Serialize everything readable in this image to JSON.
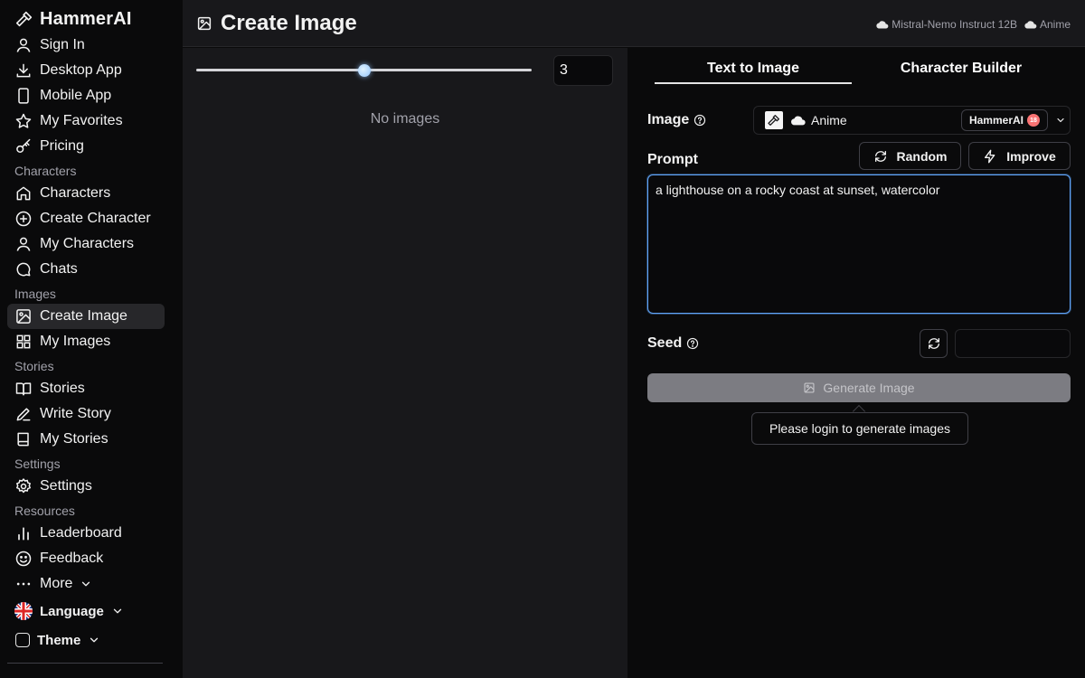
{
  "sidebar": {
    "brand": "HammerAI",
    "top_items": [
      {
        "label": "Sign In",
        "icon": "user-icon"
      },
      {
        "label": "Desktop App",
        "icon": "download-icon"
      },
      {
        "label": "Mobile App",
        "icon": "phone-icon"
      },
      {
        "label": "My Favorites",
        "icon": "star-icon"
      },
      {
        "label": "Pricing",
        "icon": "key-icon"
      }
    ],
    "sections": {
      "characters": "Characters",
      "images": "Images",
      "stories": "Stories",
      "settings": "Settings",
      "resources": "Resources"
    },
    "character_items": [
      {
        "label": "Characters",
        "icon": "home-icon"
      },
      {
        "label": "Create Character",
        "icon": "plus-circle-icon"
      },
      {
        "label": "My Characters",
        "icon": "user-icon"
      },
      {
        "label": "Chats",
        "icon": "chat-icon"
      }
    ],
    "image_items": [
      {
        "label": "Create Image",
        "icon": "image-icon",
        "active": true
      },
      {
        "label": "My Images",
        "icon": "grid-icon"
      }
    ],
    "story_items": [
      {
        "label": "Stories",
        "icon": "book-open-icon"
      },
      {
        "label": "Write Story",
        "icon": "pen-icon"
      },
      {
        "label": "My Stories",
        "icon": "book-icon"
      }
    ],
    "settings_items": [
      {
        "label": "Settings",
        "icon": "gear-icon"
      }
    ],
    "resource_items": [
      {
        "label": "Leaderboard",
        "icon": "bar-chart-icon"
      },
      {
        "label": "Feedback",
        "icon": "smile-icon"
      },
      {
        "label": "More",
        "icon": "more-icon"
      }
    ],
    "language_label": "Language",
    "theme_label": "Theme"
  },
  "header": {
    "title": "Create Image",
    "model_text": "Mistral-Nemo Instruct 12B",
    "image_model": "Anime"
  },
  "gallery": {
    "image_count": "3",
    "slider_value": 0.5,
    "empty_text": "No images"
  },
  "panel": {
    "tabs": [
      "Text to Image",
      "Character Builder"
    ],
    "image_label": "Image",
    "image_model": "Anime",
    "badge": "HammerAI",
    "badge_rating": "18",
    "prompt_label": "Prompt",
    "random_label": "Random",
    "improve_label": "Improve",
    "prompt_value": "a lighthouse on a rocky coast at sunset, watercolor",
    "seed_label": "Seed",
    "seed_value": "",
    "generate_label": "Generate Image",
    "tooltip": "Please login to generate images"
  },
  "colors": {
    "accent": "#60a5fa",
    "background": "#0a0a0b",
    "panel": "#18181b"
  }
}
